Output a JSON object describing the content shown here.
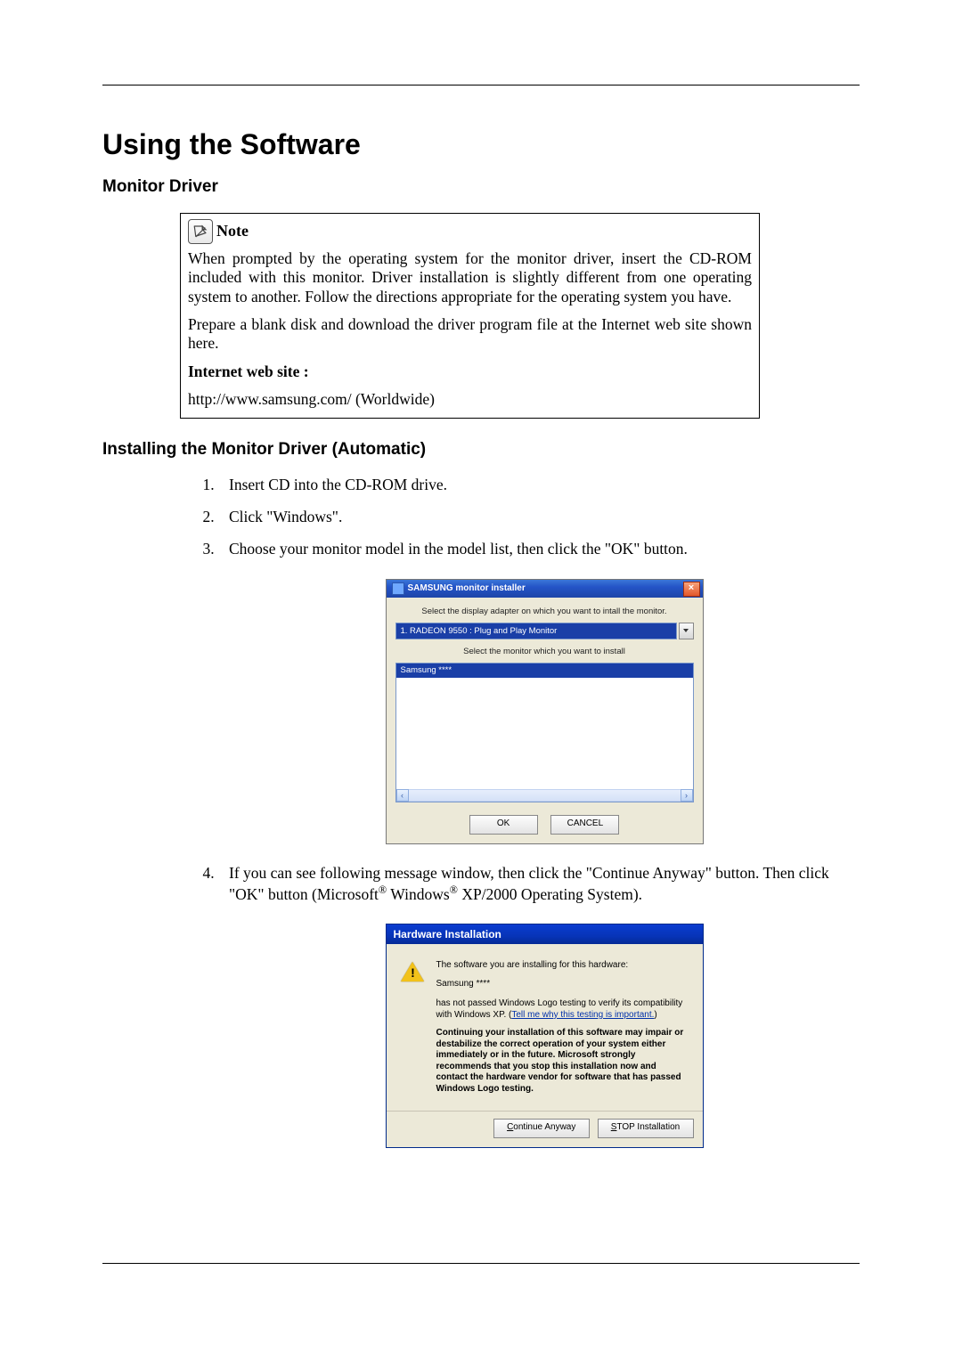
{
  "page_title": "Using the Software",
  "section1": "Monitor Driver",
  "note": {
    "label": "Note",
    "p1": "When prompted by the operating system for the monitor driver, insert the CD-ROM included with this monitor. Driver installation is slightly different from one operating system to another. Follow the directions appropriate for the operating system you have.",
    "p2": "Prepare a blank disk and download the driver program file at the Internet web site shown here.",
    "internet_label": "Internet web site :",
    "url": "http://www.samsung.com/ (Worldwide)"
  },
  "section2": "Installing the Monitor Driver (Automatic)",
  "steps": {
    "s1": "Insert CD into the CD-ROM drive.",
    "s2": "Click \"Windows\".",
    "s3": "Choose your monitor model in the model list, then click the \"OK\" button.",
    "s4_a": "If you can see following message window, then click the \"Continue Anyway\" button. Then click \"OK\" button (Microsoft",
    "s4_b": " Windows",
    "s4_c": " XP/2000 Operating System)."
  },
  "installer": {
    "title": "SAMSUNG monitor installer",
    "instr1": "Select the display adapter on which you want to intall the monitor.",
    "adapter": "1. RADEON 9550 : Plug and Play Monitor",
    "instr2": "Select the monitor which you want to install",
    "selected": "Samsung ****",
    "ok": "OK",
    "cancel": "CANCEL"
  },
  "warning": {
    "title": "Hardware Installation",
    "line1": "The software you are installing for this hardware:",
    "hw": "Samsung ****",
    "line2a": "has not passed Windows Logo testing to verify its compatibility with Windows XP. (",
    "link": "Tell me why this testing is important.",
    "line2b": ")",
    "bold": "Continuing your installation of this software may impair or destabilize the correct operation of your system either immediately or in the future. Microsoft strongly recommends that you stop this installation now and contact the hardware vendor for software that has passed Windows Logo testing.",
    "continue_u": "C",
    "continue_rest": "ontinue Anyway",
    "stop_u": "S",
    "stop_rest": "TOP Installation"
  }
}
